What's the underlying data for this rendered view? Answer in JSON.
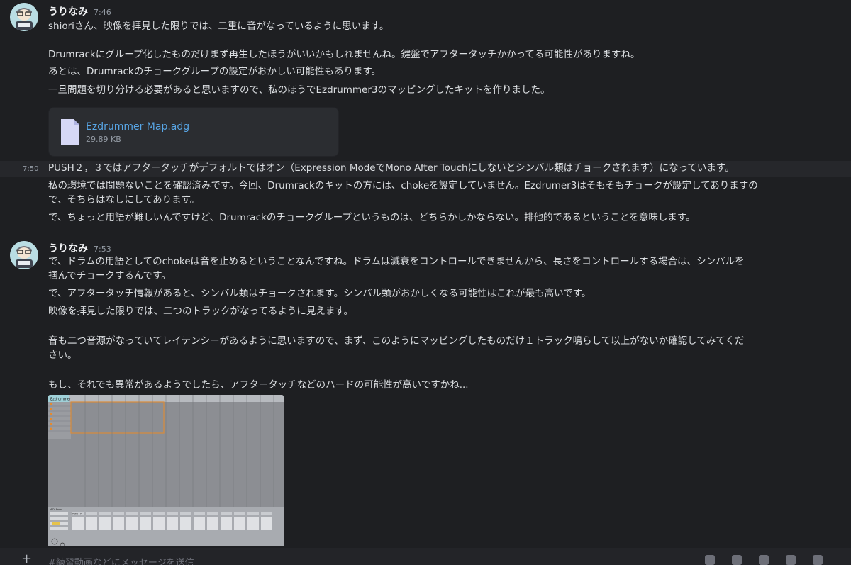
{
  "messages": [
    {
      "author": "うりなみ",
      "time": "7:46",
      "lines": [
        "shioriさん、映像を拝見した限りでは、二重に音がなっているように思います。",
        "Drumrackにグループ化したものだけまず再生したほうがいいかもしれませんね。鍵盤でアフタータッチかかってる可能性がありますね。",
        "あとは、Drumrackのチョークグループの設定がおかしい可能性もあります。",
        "一旦問題を切り分ける必要があると思いますので、私のほうでEzdrummer3のマッピングしたキットを作りました。"
      ],
      "attachment": {
        "name": "Ezdrummer Map.adg",
        "size": "29.89 KB"
      }
    },
    {
      "time": "7:50",
      "lines": [
        "PUSH２，３ではアフタータッチがデフォルトではオン（Expression ModeでMono After Touchにしないとシンバル類はチョークされます）になっています。",
        "私の環境では問題ないことを確認済みです。今回、Drumrackのキットの方には、chokeを設定していません。Ezdrumer3はそもそもチョークが設定してありますの",
        "で、そちらはなしにしてあります。",
        "で、ちょっと用語が難しいんですけど、Drumrackのチョークグループというものは、どちらかしかならない。排他的であるということを意味します。"
      ]
    },
    {
      "author": "うりなみ",
      "time": "7:53",
      "lines": [
        "で、ドラムの用語としてのchokeは音を止めるということなんですね。ドラムは減衰をコントロールできませんから、長さをコントロールする場合は、シンバルを",
        "掴んでチョークするんです。",
        "で、アフタータッチ情報があると、シンバル類はチョークされます。シンバル類がおかしくなる可能性はこれが最も高いです。",
        "映像を拝見した限りでは、二つのトラックがなってるように見えます。",
        "音も二つ音源がなっていてレイテンシーがあるように思いますので、まず、このようにマッピングしたものだけ１トラック鳴らして以上がないか確認してみてくだ",
        "さい。",
        "もし、それでも異常があるようでしたら、アフタータッチなどのハードの可能性が高いですかね..."
      ],
      "image": {
        "header_label": "Ezdrummer",
        "cell_label": "Ezd..drums",
        "device_label": "Mono | Pl",
        "midi_label": "MIDI From"
      }
    }
  ],
  "composer": {
    "placeholder": "#練習動画などにメッセージを送信"
  },
  "colors": {
    "background": "#1e1f22",
    "link": "#58a6e6",
    "hover": "#26272b"
  }
}
